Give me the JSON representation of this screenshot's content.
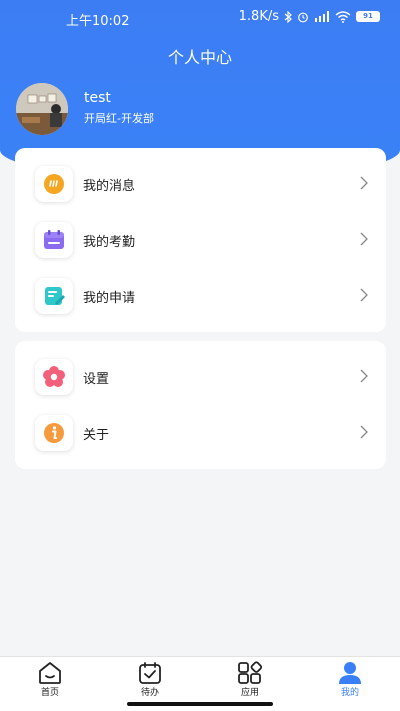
{
  "status_bar": {
    "time": "上午10:02",
    "network_speed": "1.8K/s",
    "battery": "91"
  },
  "header": {
    "title": "个人中心"
  },
  "profile": {
    "name": "test",
    "department": "开局红-开发部"
  },
  "menu_group_1": [
    {
      "label": "我的消息",
      "icon": "message-icon",
      "color": "#f5a623"
    },
    {
      "label": "我的考勤",
      "icon": "calendar-icon",
      "color": "#8b6cf0"
    },
    {
      "label": "我的申请",
      "icon": "edit-document-icon",
      "color": "#2fc7c7"
    }
  ],
  "menu_group_2": [
    {
      "label": "设置",
      "icon": "flower-settings-icon",
      "color": "#f2607a"
    },
    {
      "label": "关于",
      "icon": "info-icon",
      "color": "#f59a3d"
    }
  ],
  "tabbar": {
    "items": [
      {
        "label": "首页",
        "icon": "home-icon"
      },
      {
        "label": "待办",
        "icon": "todo-icon"
      },
      {
        "label": "应用",
        "icon": "apps-icon"
      },
      {
        "label": "我的",
        "icon": "user-icon",
        "active": true
      }
    ]
  },
  "colors": {
    "primary": "#3a7ff5",
    "background": "#f4f5f7"
  }
}
